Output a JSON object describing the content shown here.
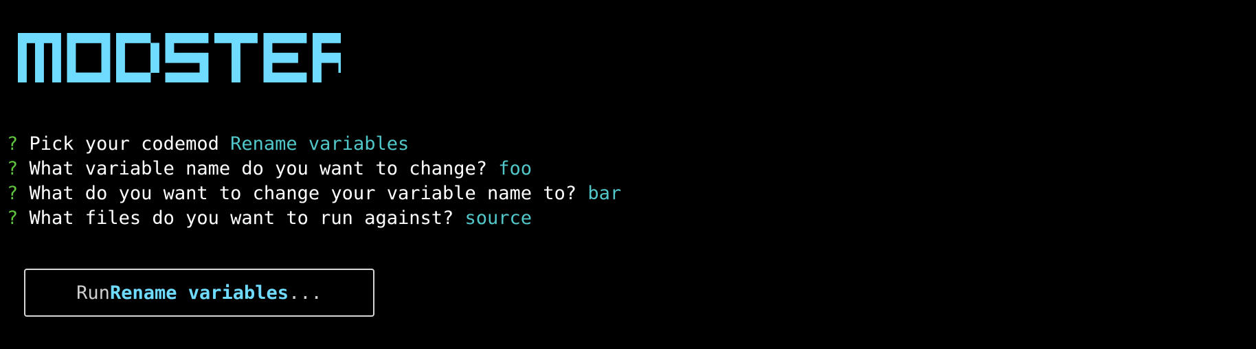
{
  "app": {
    "logo_text": "MODSTER",
    "logo_color": "#6fdcff"
  },
  "colors": {
    "background": "#000000",
    "prompt_marker": "#5fc33f",
    "answer": "#52c7c9",
    "highlight": "#6fdcff",
    "text": "#ffffff"
  },
  "prompts": [
    {
      "marker": "?",
      "question": "Pick your codemod",
      "answer": "Rename variables"
    },
    {
      "marker": "?",
      "question": "What variable name do you want to change?",
      "answer": "foo"
    },
    {
      "marker": "?",
      "question": "What do you want to change your variable name to?",
      "answer": "bar"
    },
    {
      "marker": "?",
      "question": "What files do you want to run against?",
      "answer": "source"
    }
  ],
  "run_status": {
    "prefix": "Run",
    "target": "Rename variables",
    "suffix": "..."
  }
}
